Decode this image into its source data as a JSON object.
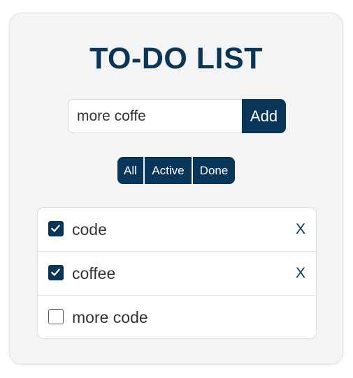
{
  "app": {
    "title": "TO-DO LIST"
  },
  "input": {
    "value": "more coffe",
    "add_label": "Add"
  },
  "filters": {
    "all_label": "All",
    "active_label": "Active",
    "done_label": "Done"
  },
  "todos": [
    {
      "text": "code",
      "done": true,
      "delete_label": "X"
    },
    {
      "text": "coffee",
      "done": true,
      "delete_label": "X"
    },
    {
      "text": "more code",
      "done": false
    }
  ],
  "colors": {
    "accent": "#083558",
    "card_bg": "#f4f4f4",
    "text": "#333333"
  },
  "icons": {
    "checkbox_checked": "checkmark-icon"
  }
}
